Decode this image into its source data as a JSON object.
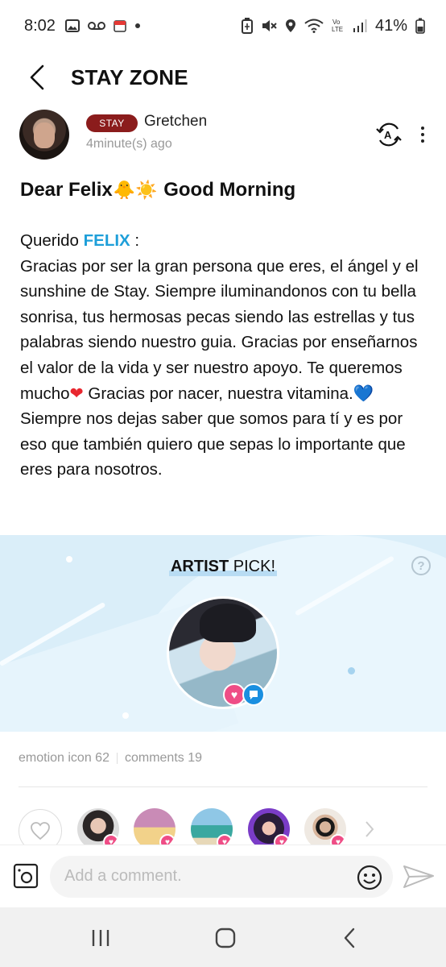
{
  "status_bar": {
    "time": "8:02",
    "battery": "41%",
    "left_icons": [
      "image-icon",
      "voicemail-icon",
      "calendar-icon",
      "dot-icon"
    ],
    "right_icons": [
      "battery-saver-icon",
      "mute-icon",
      "location-icon",
      "wifi-icon",
      "volte-icon",
      "signal-icon",
      "battery-icon"
    ]
  },
  "header": {
    "title": "STAY ZONE"
  },
  "post": {
    "badge": "STAY",
    "author": "Gretchen",
    "time": "4minute(s) ago",
    "title_before": "Dear Felix",
    "title_emojis": "🐥☀️",
    "title_after": " Good Morning",
    "body": {
      "greeting_prefix": "Querido ",
      "greeting_name": "FELIX",
      "greeting_suffix": " :",
      "text_1": "Gracias por ser la gran persona que eres, el ángel y el sunshine de Stay. Siempre iluminandonos con tu bella sonrisa, tus hermosas pecas siendo las estrellas y tus palabras siendo nuestro guia. Gracias por enseñarnos el valor de la vida y ser nuestro apoyo. Te queremos mucho",
      "heart_1": "❤",
      "text_2": " Gracias por nacer, nuestra vitamina.",
      "heart_2": "💙",
      "text_3": " Siempre nos dejas saber que somos para tí y es por eso que también quiero que sepas lo importante que eres para nosotros."
    }
  },
  "artist_pick": {
    "title_bold": "ARTIST",
    "title_rest": " PICK!",
    "help": "?"
  },
  "stats": {
    "emotion": "emotion icon 62",
    "comments": "comments 19"
  },
  "comment_bar": {
    "placeholder": "Add a comment."
  },
  "colors": {
    "accent_blue": "#1e9fd9",
    "badge_red": "#8b1c1c",
    "pink": "#ef4d86",
    "banner_bg": "#daeef9"
  }
}
